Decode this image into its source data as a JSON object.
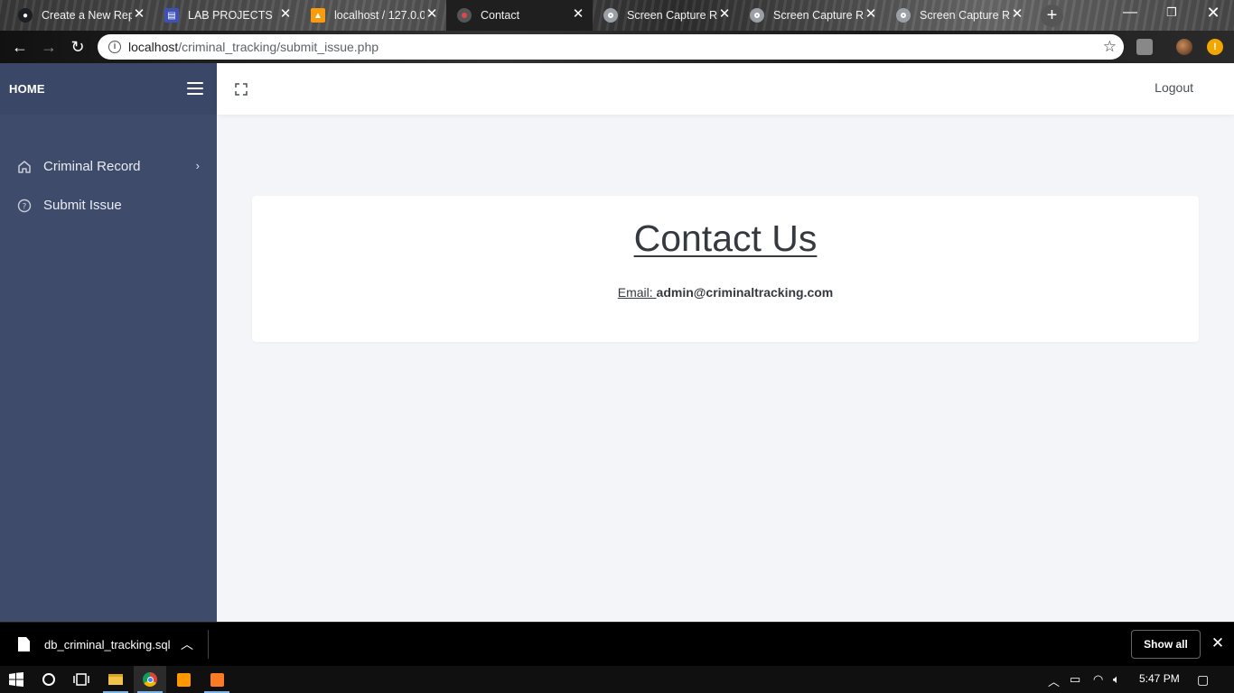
{
  "browser": {
    "tabs": [
      {
        "title": "Create a New Repo",
        "icon": "github-icon",
        "icon_color": "#1b1f23",
        "active": false
      },
      {
        "title": "LAB PROJECTS",
        "icon": "layout-icon",
        "icon_color": "#3f51b5",
        "active": false
      },
      {
        "title": "localhost / 127.0.0",
        "icon": "phpmyadmin-icon",
        "icon_color": "#f89c0e",
        "active": false
      },
      {
        "title": "Contact",
        "icon": "site-icon",
        "icon_color": "#e04848",
        "active": true
      },
      {
        "title": "Screen Capture Re",
        "icon": "camera-icon",
        "icon_color": "#9aa0a6",
        "active": false
      },
      {
        "title": "Screen Capture Re",
        "icon": "camera-icon",
        "icon_color": "#9aa0a6",
        "active": false
      },
      {
        "title": "Screen Capture Re",
        "icon": "camera-icon",
        "icon_color": "#9aa0a6",
        "active": false
      }
    ],
    "url_host": "localhost",
    "url_path": "/criminal_tracking/submit_issue.php"
  },
  "sidebar": {
    "brand": "HOME",
    "items": [
      {
        "label": "Criminal Record",
        "icon": "home-icon",
        "has_submenu": true
      },
      {
        "label": "Submit Issue",
        "icon": "help-circle-icon",
        "has_submenu": false
      }
    ]
  },
  "topbar": {
    "logout_label": "Logout"
  },
  "contact": {
    "title": "Contact Us",
    "email_label": "Email: ",
    "email_value": "admin@criminaltracking.com"
  },
  "downloads": {
    "file_name": "db_criminal_tracking.sql",
    "show_all_label": "Show all"
  },
  "taskbar": {
    "time": "5:47 PM"
  },
  "colors": {
    "sidebar_bg": "#3e4b6b",
    "page_bg": "#f4f5f9",
    "card_bg": "#ffffff",
    "text_dark": "#343a40"
  }
}
